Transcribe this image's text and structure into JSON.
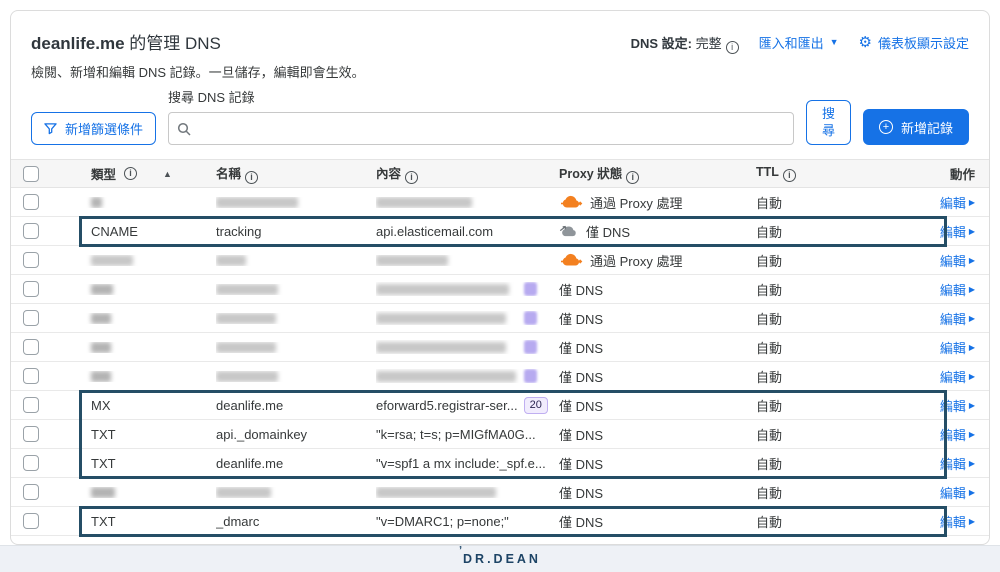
{
  "icons": {
    "info": "i",
    "sort_asc": "▲",
    "caret_down": "▼",
    "caret_right": "▶",
    "gear": "⚙",
    "plus": "+"
  },
  "page": {
    "title_domain": "deanlife.me",
    "title_rest": " 的管理 DNS",
    "subtitle": "檢閱、新增和編輯 DNS 記錄。一旦儲存，編輯即會生效。",
    "dns_setting_label": "DNS 設定:",
    "dns_setting_value": "完整",
    "import_export_label": "匯入和匯出",
    "dashboard_settings_label": "儀表板顯示設定"
  },
  "toolbar": {
    "filter_button_label": "新增篩選條件",
    "search_label": "搜尋 DNS 記錄",
    "search_placeholder": "",
    "search_button_label": "搜尋",
    "add_record_button_label": "新增記錄"
  },
  "table": {
    "headers": {
      "type": "類型",
      "name": "名稱",
      "content": "內容",
      "proxy": "Proxy 狀態",
      "ttl": "TTL",
      "action": "動作"
    },
    "proxy_states": {
      "proxied": "通過 Proxy 處理",
      "dns_only": "僅 DNS"
    },
    "rows": [
      {
        "redacted": true,
        "proxy": "通過 Proxy 處理",
        "ttl": "自動",
        "action": "編輯"
      },
      {
        "redacted": false,
        "type": "CNAME",
        "name": "tracking",
        "content": "api.elasticemail.com",
        "proxy": "僅 DNS",
        "ttl": "自動",
        "action": "編輯",
        "highlighted": true
      },
      {
        "redacted": true,
        "proxy": "通過 Proxy 處理",
        "ttl": "自動",
        "action": "編輯"
      },
      {
        "redacted": true,
        "proxy": "僅 DNS",
        "ttl": "自動",
        "action": "編輯"
      },
      {
        "redacted": true,
        "proxy": "僅 DNS",
        "ttl": "自動",
        "action": "編輯"
      },
      {
        "redacted": true,
        "proxy": "僅 DNS",
        "ttl": "自動",
        "action": "編輯"
      },
      {
        "redacted": true,
        "proxy": "僅 DNS",
        "ttl": "自動",
        "action": "編輯"
      },
      {
        "redacted": false,
        "type": "MX",
        "name": "deanlife.me",
        "content": "eforward5.registrar-ser...",
        "priority": "20",
        "proxy": "僅 DNS",
        "ttl": "自動",
        "action": "編輯",
        "highlighted": true
      },
      {
        "redacted": false,
        "type": "TXT",
        "name": "api._domainkey",
        "content": "\"k=rsa; t=s; p=MIGfMA0G...",
        "proxy": "僅 DNS",
        "ttl": "自動",
        "action": "編輯",
        "highlighted": true
      },
      {
        "redacted": false,
        "type": "TXT",
        "name": "deanlife.me",
        "content": "\"v=spf1 a mx include:_spf.e...",
        "proxy": "僅 DNS",
        "ttl": "自動",
        "action": "編輯",
        "highlighted": true
      },
      {
        "redacted": true,
        "proxy": "僅 DNS",
        "ttl": "自動",
        "action": "編輯"
      },
      {
        "redacted": false,
        "type": "TXT",
        "name": "_dmarc",
        "content": "\"v=DMARC1; p=none;\"",
        "proxy": "僅 DNS",
        "ttl": "自動",
        "action": "編輯",
        "highlighted": true
      }
    ]
  },
  "footer": {
    "logo_text": "DR.DEAN"
  }
}
